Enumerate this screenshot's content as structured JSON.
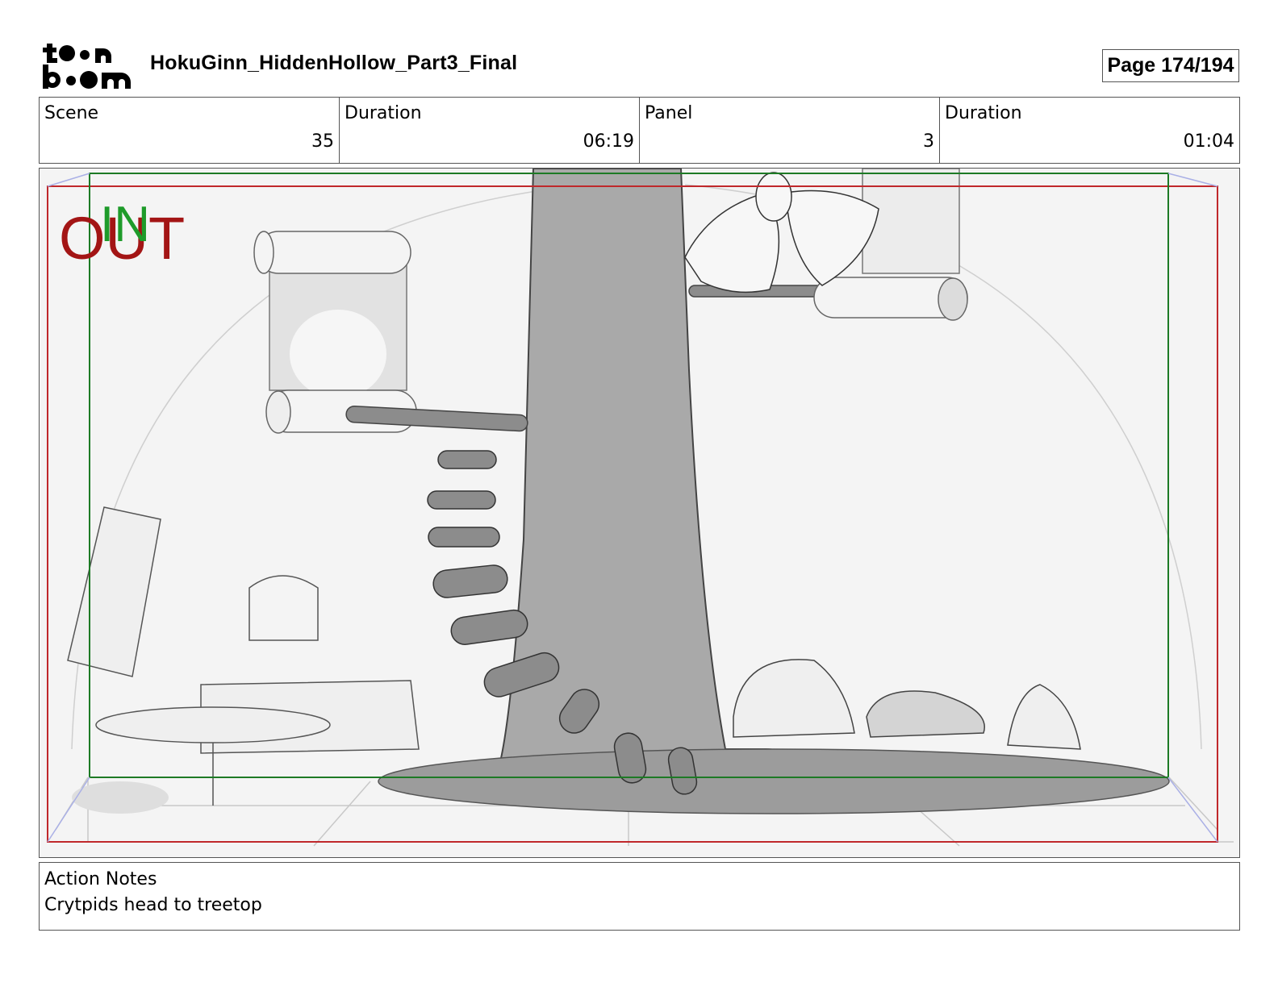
{
  "header": {
    "logo_text_top": "toon",
    "logo_text_bottom": "boom",
    "document_title": "HokuGinn_HiddenHollow_Part3_Final",
    "page_indicator": "Page 174/194"
  },
  "info": {
    "scene_label": "Scene",
    "scene_value": "35",
    "scene_duration_label": "Duration",
    "scene_duration_value": "06:19",
    "panel_label": "Panel",
    "panel_value": "3",
    "panel_duration_label": "Duration",
    "panel_duration_value": "01:04"
  },
  "panel": {
    "in_marker": "IN",
    "out_marker": "OUT",
    "in_color": "#1e9b2a",
    "out_color": "#a31515",
    "safe_frame_color": "#1d7a25",
    "camera_frame_color": "#c0282b"
  },
  "notes": {
    "label": "Action Notes",
    "text": "Crytpids head to treetop"
  }
}
